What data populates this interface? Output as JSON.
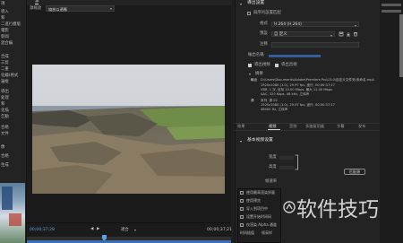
{
  "colors": {
    "accent_blue": "#5da0e6",
    "panel_bg": "#232323",
    "preview_bg": "#1b1b1b"
  },
  "sidebar": {
    "items": [
      "項",
      "導入",
      "和",
      "二進行模版",
      "電影",
      "新闻",
      "混合编",
      "合成",
      "三剪",
      "二重",
      "化繪(格式",
      "邊框",
      "導出",
      "处理",
      "和",
      "化描",
      "乞動",
      "合格",
      "文件",
      "像",
      "合格",
      "生成"
    ]
  },
  "preview": {
    "tab_label": "源",
    "source_label": "源縮放",
    "source_value": "縮放以適應",
    "timecode_in": "00;00;37;28",
    "timecode_out": "00;00;37;21",
    "fit_label": "適合",
    "mark_in": "◀",
    "mark_out": "▶"
  },
  "export": {
    "section_title": "導出設置",
    "match_sequence_label": "與序列設置匹配",
    "format_label": "格式",
    "format_value": "H.264 (H.264)",
    "preset_label": "預設",
    "preset_value": "自 定义",
    "comments_label": "注释",
    "output_name_label": "輸出名稱",
    "export_video_label": "導出視頻",
    "export_audio_label": "導出音頻",
    "summary_title": "摘要",
    "summary_output_label": "輸出",
    "summary_output_path": "D:\\Users\\Documents\\Adobe\\Premiere Pro\\13.0\\自定义文件夹\\未命名.mp4",
    "summary_output_lines": [
      "1920x1080 (1.0), 29.97 fps, 逐行, 00;00:37;17",
      "VBR, 1 次, 目标 10.00 Mbps, 最大 12.00 Mbps",
      "AAC, 320 Kbps, 48 kHz, 立体声"
    ],
    "summary_source_label": "源",
    "summary_source_name": "序列, 源 02",
    "summary_source_lines": [
      "1920x1080 (1.0), 29.97 fps, 逐行, 00;00:37;17",
      "48000 Hz, 立体声"
    ]
  },
  "tabs": [
    "效果",
    "视频",
    "音频",
    "多路复用器",
    "字幕",
    "发布"
  ],
  "video": {
    "section_title": "基本视频设置",
    "width_label": "宽度",
    "height_label": "高度",
    "match_source_button": "匹配源",
    "frame_rate_label": "帧速率"
  },
  "popup": {
    "items": [
      "使用最高渲染质量",
      "使用预览",
      "导入到项目中",
      "设置开始时间码",
      "仅渲染 Alpha 通道",
      "时间插值",
      "帧采样"
    ]
  },
  "watermark": {
    "text": "软件技巧"
  }
}
